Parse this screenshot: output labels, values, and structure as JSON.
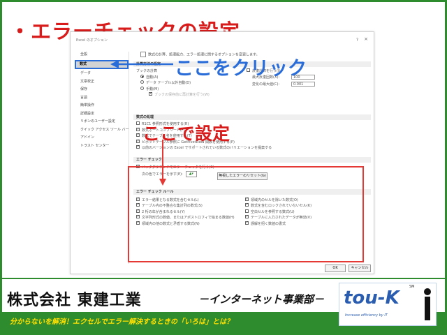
{
  "headline": "・エラーチェックの設定",
  "dialog": {
    "title": "Excel のオプション",
    "help": "?",
    "close": "×",
    "sidebar": [
      "全般",
      "数式",
      "データ",
      "文章校正",
      "保存",
      "言語",
      "簡単操作",
      "詳細設定",
      "リボンのユーザー設定",
      "クイック アクセス ツール バー",
      "アドイン",
      "トラスト センター"
    ],
    "intro": "数式の計算、処理能力、エラー処理に関するオプションを変更します。",
    "calc_section": "計算方法の設定",
    "workbook_calc": "ブックの計算",
    "auto": "自動(A)",
    "auto_except": "データ テーブル以外自動(D)",
    "manual": "手動(M)",
    "recalc_before_save": "ブックの保存前に再計算を行う(W)",
    "iterative": "反復計算を行う(I)",
    "max_iter_label": "最大反復回数(X):",
    "max_iter": "100",
    "max_change_label": "変化の最大値(C):",
    "max_change": "0.001",
    "formula_section": "数式の処理",
    "formula_rows": [
      "R1C1 参照形式を使用する(R)",
      "数式オートコンプリート(F)",
      "数式でテーブル名を使用する(T)",
      "ピボットテーブル参照に GetPivotData 関数を使用する(P)",
      "以前のバージョンの Excel でサポートされている数式のバリエーションを提案する"
    ],
    "error_section": "エラー チェック",
    "bg_check": "バックグラウンドでエラー チェックを行う(B)",
    "color_label": "次の色でエラーを示す(E):",
    "reset_button": "無視したエラーのリセット(G)",
    "rules_section": "エラー チェック ルール",
    "rules_left": [
      "エラー結果となる数式を含むセル(L)",
      "テーブル内の不整合な集計列の数式(S)",
      "2 桁の年が含まれるセル(Y)",
      "文字列形式の数値、またはアポストロフィで始まる数値(H)",
      "領域内の他の数式と矛盾する数式(N)"
    ],
    "rules_right": [
      "領域内のセルを除いた数式(O)",
      "数式を含むロックされていないセル(K)",
      "空白セルを参照する数式(U)",
      "テーブルに入力されたデータが無効(V)",
      "誤解を招く数値の書式"
    ],
    "ok": "OK",
    "cancel": "キャンセル"
  },
  "annotations": {
    "click_here": "ここをクリック",
    "set_here": "ここで設定"
  },
  "footer": {
    "company": "株式会社 東建工業",
    "dept": "－インターネット事業部－",
    "tagline": "分からないを解消！エクセルでエラー解決するときの「いろは」とは？",
    "logo": "tou-K",
    "logo_sub": "Increase efficiency by IT",
    "logo_sm": "SM"
  },
  "colors": {
    "accent_red": "#d81b1b",
    "annotation_blue": "#2a6dd9",
    "brand_green": "#2e8b2e",
    "tagline_yellow": "#ffe000"
  }
}
